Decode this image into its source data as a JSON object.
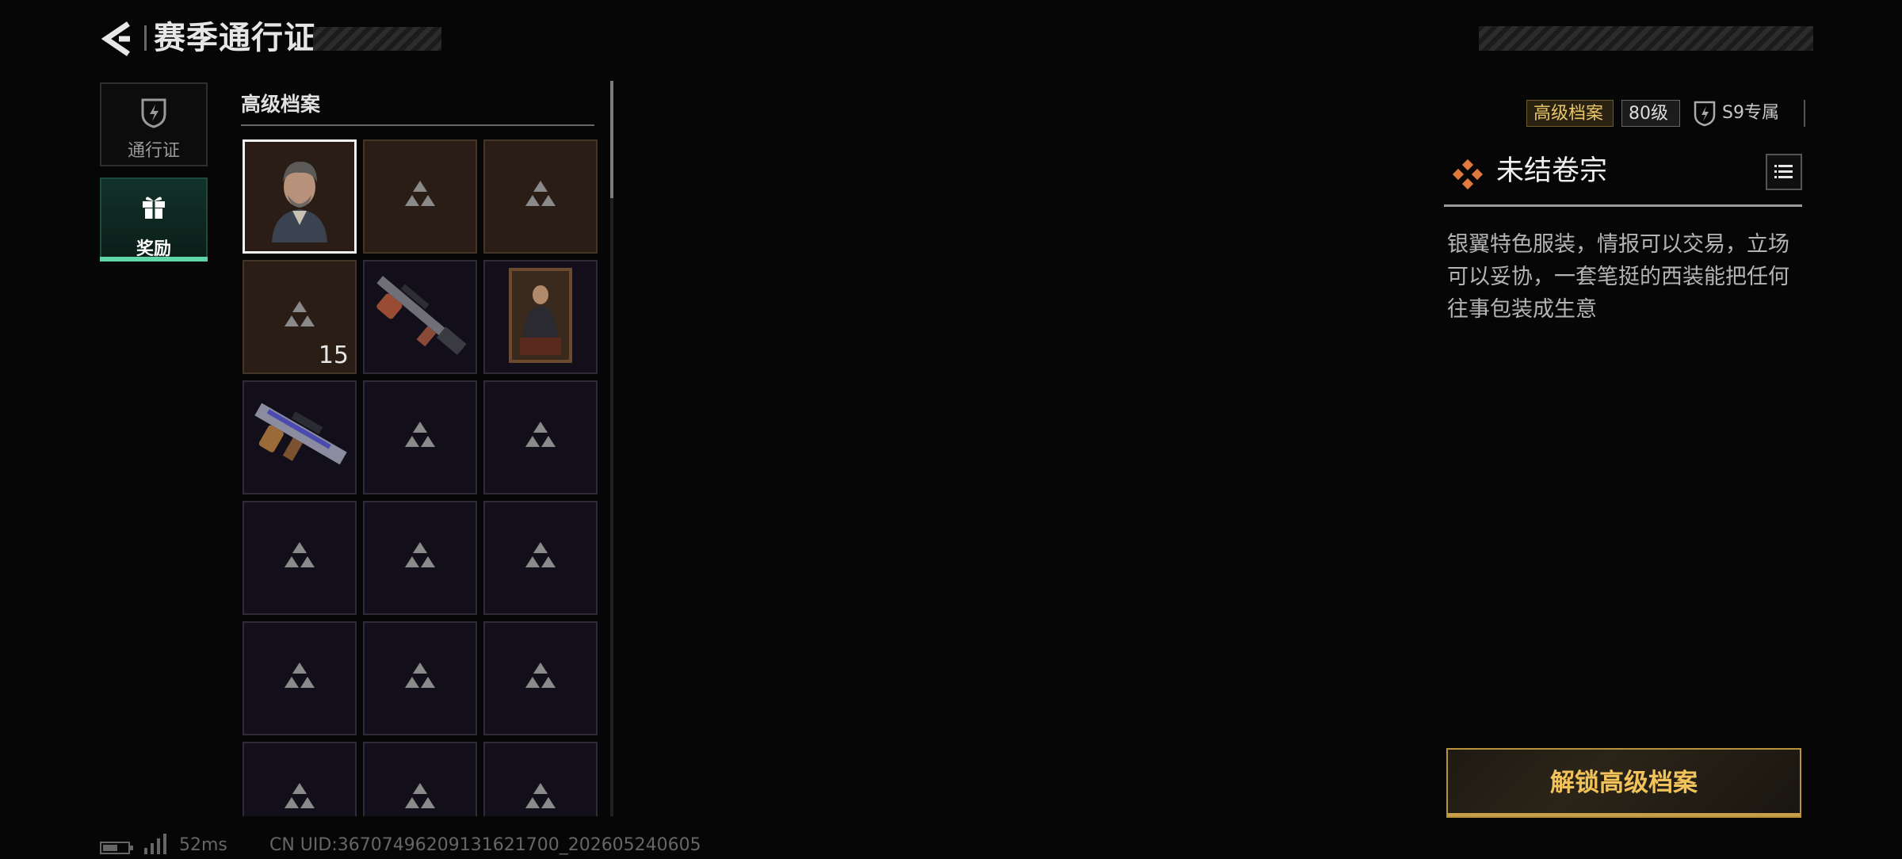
{
  "header": {
    "title": "赛季通行证",
    "back_icon": "chevron-left-icon"
  },
  "nav": {
    "items": [
      {
        "label": "通行证",
        "icon": "pass-shield-icon",
        "active": false
      },
      {
        "label": "奖励",
        "icon": "gift-icon",
        "active": true
      }
    ],
    "active_color": "#5fd6a7"
  },
  "rewards": {
    "section_title": "高级档案",
    "cells": [
      {
        "kind": "portrait",
        "tier": "brown",
        "selected": true
      },
      {
        "kind": "placeholder",
        "tier": "brown"
      },
      {
        "kind": "placeholder",
        "tier": "brown"
      },
      {
        "kind": "placeholder",
        "tier": "brown",
        "quantity": "15"
      },
      {
        "kind": "rifle-skin",
        "tier": "purple"
      },
      {
        "kind": "poster",
        "tier": "purple"
      },
      {
        "kind": "smg-skin",
        "tier": "purple"
      },
      {
        "kind": "placeholder",
        "tier": "purple"
      },
      {
        "kind": "placeholder",
        "tier": "purple"
      },
      {
        "kind": "placeholder",
        "tier": "purple"
      },
      {
        "kind": "placeholder",
        "tier": "purple"
      },
      {
        "kind": "placeholder",
        "tier": "purple"
      },
      {
        "kind": "placeholder",
        "tier": "purple"
      },
      {
        "kind": "placeholder",
        "tier": "purple"
      },
      {
        "kind": "placeholder",
        "tier": "purple"
      },
      {
        "kind": "placeholder",
        "tier": "purple"
      },
      {
        "kind": "placeholder",
        "tier": "purple"
      },
      {
        "kind": "placeholder",
        "tier": "purple"
      }
    ]
  },
  "detail": {
    "tag_premium": "高级档案",
    "tag_level": "80级",
    "tag_exclusive": "S9专属",
    "item_name": "未结卷宗",
    "item_icon": "diamond-cluster-icon",
    "description": "银翼特色服装，情报可以交易，立场可以妥协，一套笔挺的西装能把任何往事包装成生意",
    "unlock_label": "解锁高级档案",
    "accent_gold": "#f2c35a",
    "item_icon_color": "#e07a3c"
  },
  "footer": {
    "ping": "52ms",
    "uid": "CN UID:3670749620913162170​0_202605240605"
  }
}
